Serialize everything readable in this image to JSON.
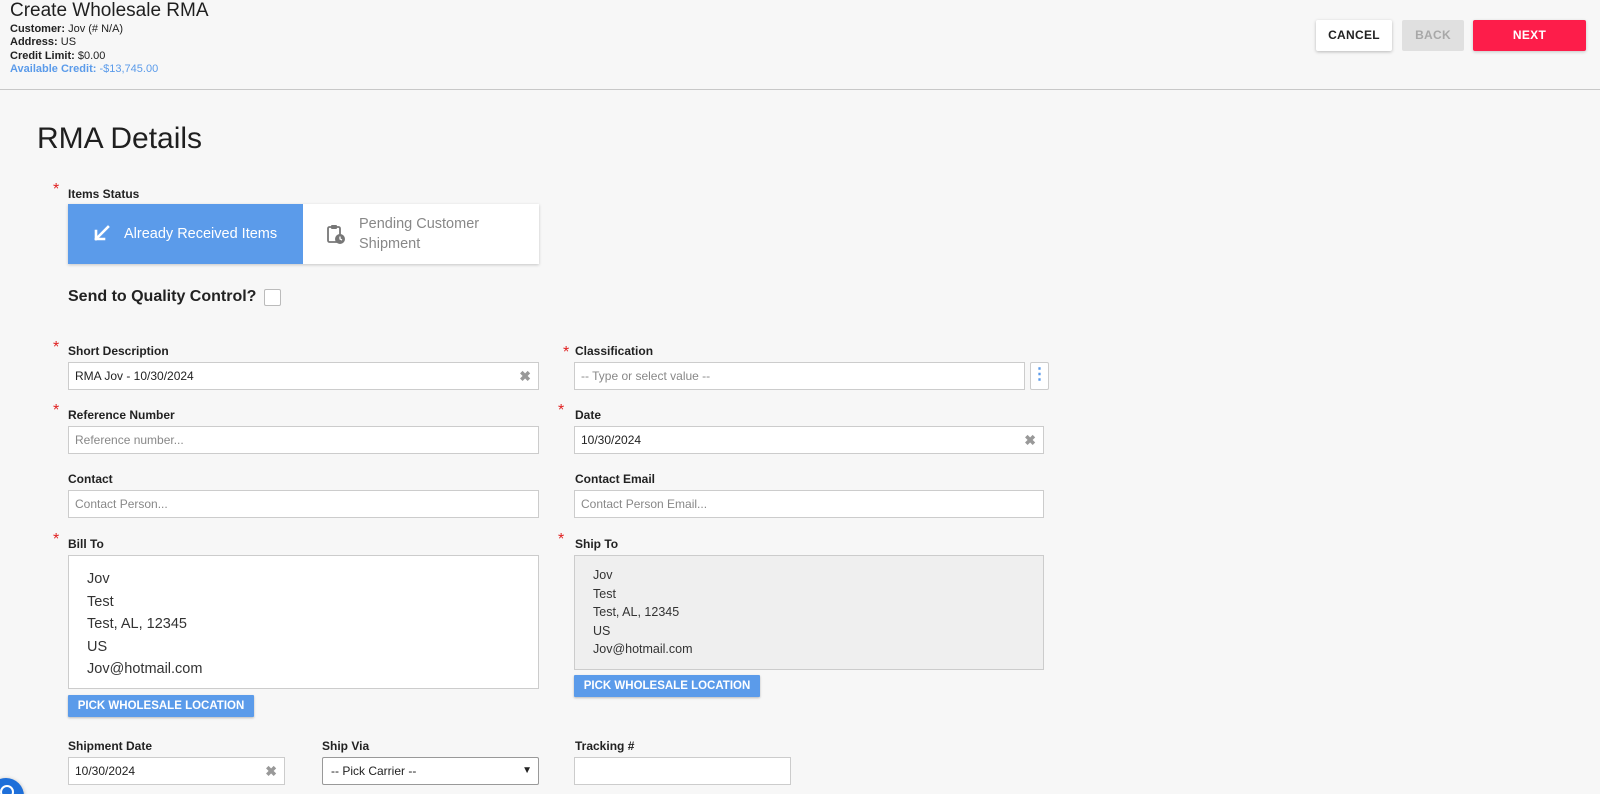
{
  "header": {
    "title": "Create Wholesale RMA",
    "customer_label": "Customer:",
    "customer_value": "Jov (# N/A)",
    "address_label": "Address:",
    "address_value": "US",
    "credit_limit_label": "Credit Limit:",
    "credit_limit_value": "$0.00",
    "available_credit_label": "Available Credit:",
    "available_credit_value": "-$13,745.00",
    "cancel_label": "CANCEL",
    "back_label": "BACK",
    "next_label": "NEXT"
  },
  "page_title": "RMA Details",
  "items_status": {
    "label": "Items Status",
    "options": [
      {
        "label": "Already Received Items",
        "icon": "arrow-down-left-icon",
        "selected": true
      },
      {
        "label": "Pending Customer Shipment",
        "icon": "clipboard-clock-icon",
        "selected": false
      }
    ]
  },
  "quality_control": {
    "label": "Send to Quality Control?",
    "checked": false
  },
  "form": {
    "short_description": {
      "label": "Short Description",
      "value": "RMA Jov - 10/30/2024"
    },
    "classification": {
      "label": "Classification",
      "placeholder": "-- Type or select value --"
    },
    "reference_number": {
      "label": "Reference Number",
      "placeholder": "Reference number..."
    },
    "date": {
      "label": "Date",
      "value": "10/30/2024"
    },
    "contact": {
      "label": "Contact",
      "placeholder": "Contact Person..."
    },
    "contact_email": {
      "label": "Contact Email",
      "placeholder": "Contact Person Email..."
    },
    "bill_to": {
      "label": "Bill To",
      "lines": [
        "Jov",
        "Test",
        "Test, AL, 12345",
        "US",
        "Jov@hotmail.com"
      ],
      "pick_label": "PICK WHOLESALE LOCATION"
    },
    "ship_to": {
      "label": "Ship To",
      "lines": [
        "Jov",
        "Test",
        "Test, AL, 12345",
        "US",
        "Jov@hotmail.com"
      ],
      "pick_label": "PICK WHOLESALE LOCATION"
    },
    "shipment_date": {
      "label": "Shipment Date",
      "value": "10/30/2024"
    },
    "ship_via": {
      "label": "Ship Via",
      "value": "-- Pick Carrier --"
    },
    "tracking": {
      "label": "Tracking #",
      "value": ""
    }
  },
  "colors": {
    "accent": "#5b9bea",
    "next_button": "#fd1d4a",
    "required": "#e02020"
  }
}
